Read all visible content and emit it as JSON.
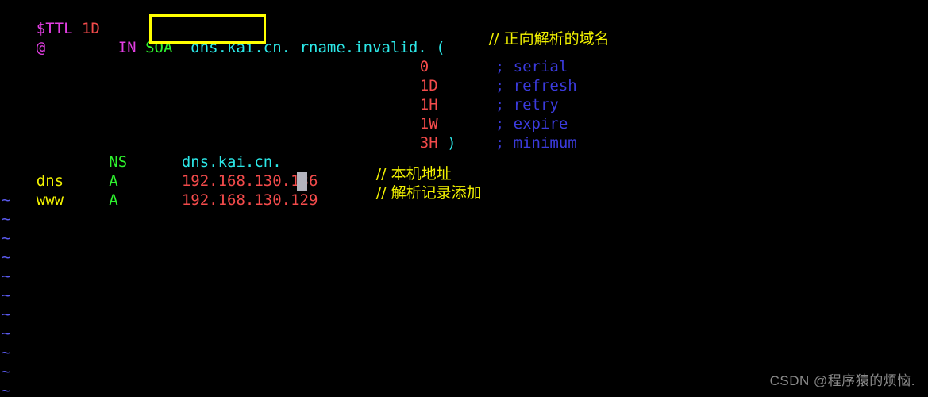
{
  "terminal": {
    "background": "#000000",
    "editor": "vim",
    "colors": {
      "magenta": "#e33ee3",
      "red": "#f44b4b",
      "green": "#2ef32e",
      "cyan": "#2ce8e8",
      "blue": "#3b3bdd",
      "yellow": "#f2f200",
      "tilde_blue": "#5b5bf0",
      "highlight_box": "#ffff00",
      "cursor": "#b3b3bd",
      "watermark": "#8a8a8a"
    }
  },
  "zone_file": {
    "ttl_directive": {
      "keyword": "$TTL",
      "value": "1D"
    },
    "soa_record": {
      "owner": "@",
      "class": "IN",
      "type": "SOA",
      "mname": "dns.kai.cn.",
      "rname": "rname.invalid.",
      "open_paren": "(",
      "comment": "// 正向解析的域名",
      "params": [
        {
          "value": "0",
          "semicolon": ";",
          "label": "serial"
        },
        {
          "value": "1D",
          "semicolon": ";",
          "label": "refresh"
        },
        {
          "value": "1H",
          "semicolon": ";",
          "label": "retry"
        },
        {
          "value": "1W",
          "semicolon": ";",
          "label": "expire"
        },
        {
          "value": "3H",
          "semicolon": ";",
          "label": "minimum",
          "close_paren": ")"
        }
      ]
    },
    "records": [
      {
        "owner": "",
        "type": "NS",
        "value": "dns.kai.cn.",
        "comment": ""
      },
      {
        "owner": "dns",
        "type": "A",
        "value": "192.168.130.136",
        "comment": "// 本机地址"
      },
      {
        "owner": "www",
        "type": "A",
        "value": "192.168.130.129",
        "comment": "// 解析记录添加"
      }
    ]
  },
  "empty_line_markers": {
    "glyph": "~",
    "count": 11
  },
  "watermark": {
    "text": "CSDN @程序猿的烦恼."
  }
}
